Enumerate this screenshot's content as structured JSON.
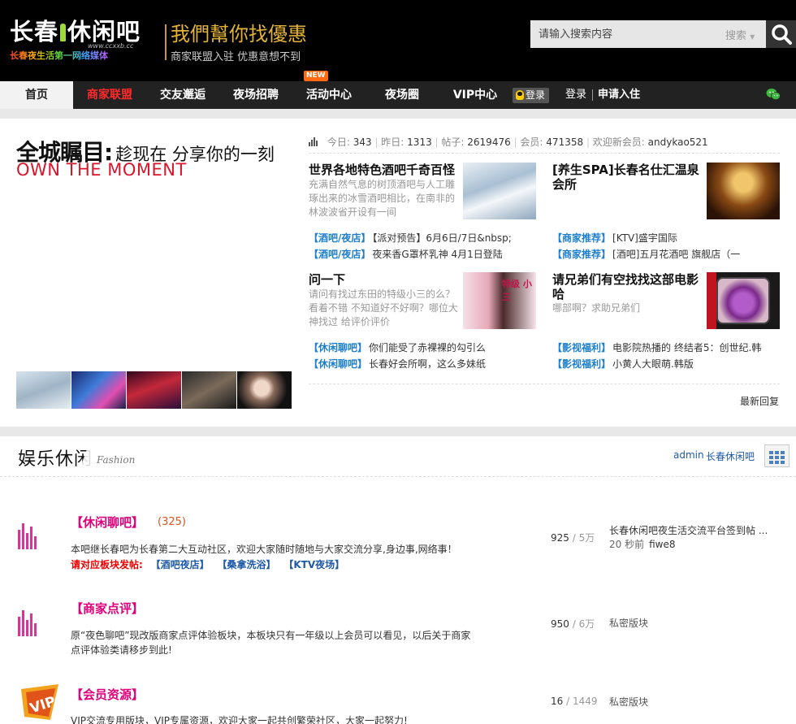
{
  "header": {
    "logo_main_left": "长春",
    "logo_main_right": "休闲吧",
    "logo_url": "www.ccxxb.cc",
    "logo_tagline": "长春夜生活第一网络媒体",
    "slogan": "我們幫你找優惠",
    "subslogan": "商家联盟入驻  优惠意想不到",
    "search_placeholder": "请输入搜索内容",
    "search_select": "搜索"
  },
  "nav": {
    "items": [
      {
        "label": "首页"
      },
      {
        "label": "商家联盟"
      },
      {
        "label": "交友邂逅"
      },
      {
        "label": "夜场招聘"
      },
      {
        "label": "活动中心"
      },
      {
        "label": "夜场圈"
      },
      {
        "label": "VIP中心"
      }
    ],
    "new_badge": "NEW",
    "qq_login": "登录",
    "login": "登录",
    "register": "申请入住"
  },
  "hero": {
    "title_big": "全城瞩目:",
    "title_small": "趁现在 分享你的一刻",
    "subtitle": "OWN THE MOMENT"
  },
  "stats": {
    "today_label": "今日:",
    "today": "343",
    "yesterday_label": "昨日:",
    "yesterday": "1313",
    "posts_label": "帖子:",
    "posts": "2619476",
    "members_label": "会员:",
    "members": "471358",
    "welcome_label": "欢迎新会员:",
    "new_member": "andykao521"
  },
  "posts": [
    {
      "title": "世界各地特色酒吧千奇百怪",
      "desc": "充满自然气息的树顶酒吧与人工雕琢出来的冰雪酒吧相比，在南非的林波波省开设有一间"
    },
    {
      "title": "[养生SPA]长春名仕汇温泉会所",
      "desc": ""
    },
    {
      "title": "问一下",
      "desc": "请问有找过东田的特级小三的么？ 看着不错 不知道好不好啊？哪位大神找过 给评价评价"
    },
    {
      "title": "请兄弟们有空找找这部电影哈",
      "desc": "哪部啊？求助兄弟们"
    }
  ],
  "post_img_text": {
    "p3": "特级 小三"
  },
  "links": [
    {
      "cat": "【酒吧/夜店】",
      "text": "【派对预告】6月6日/7日&nbsp;"
    },
    {
      "cat": "【商家推荐】",
      "text": "[KTV]盛宇国际"
    },
    {
      "cat": "【酒吧/夜店】",
      "text": "夜来香G罩杯乳神 4月1日登陆"
    },
    {
      "cat": "【商家推荐】",
      "text": "[酒吧]五月花酒吧 旗舰店（一"
    },
    {
      "cat": "【休闲聊吧】",
      "text": "你们能受了赤裸裸的勾引么"
    },
    {
      "cat": "【影视福利】",
      "text": "电影院热播的 终结者5：创世纪.韩"
    },
    {
      "cat": "【休闲聊吧】",
      "text": "长春好会所啊，这么多妹纸"
    },
    {
      "cat": "【影视福利】",
      "text": "小黄人大眼萌.韩版"
    }
  ],
  "latest_reply": "最新回复",
  "section": {
    "title": "娱乐休闲",
    "title_en": "Fashion",
    "admin": "admin",
    "moderator": "长春休闲吧"
  },
  "forums": [
    {
      "name": "【休闲聊吧】",
      "count": "(325)",
      "desc": "本吧继长春吧为长春第二大互动社区，欢迎大家随时随地与大家交流分享,身边事,网络事！",
      "sub_label": "请对应板块发帖:",
      "sub_links": [
        "【酒吧夜店】",
        "【桑拿洗浴】",
        "【KTV夜场】"
      ],
      "threads": "925",
      "posts": "5万",
      "last_title": "长春休闲吧夜生活交流平台签到帖 ...",
      "last_time": "20 秒前",
      "last_user": "fiwe8"
    },
    {
      "name": "【商家点评】",
      "desc": "原“夜色聊吧”现改版商家点评体验板块，本板块只有一年级以上会员可以看见，以后关于商家点评体验类请移步到此!",
      "threads": "950",
      "posts": "6万",
      "private": "私密版块"
    },
    {
      "name": "【会员资源】",
      "desc": "VIP交流专用版块，VIP专属资源，欢迎大家一起共创繁荣社区，大家一起努力!",
      "threads": "16",
      "posts": "1449",
      "private": "私密版块"
    }
  ],
  "colors": {
    "header_bg": "#000000",
    "nav_bg": "#222222",
    "accent_red": "#d7162c",
    "link_blue": "#1e7fcf",
    "forum_pink": "#e0007a",
    "slogan_gold": "#e2b23a"
  }
}
